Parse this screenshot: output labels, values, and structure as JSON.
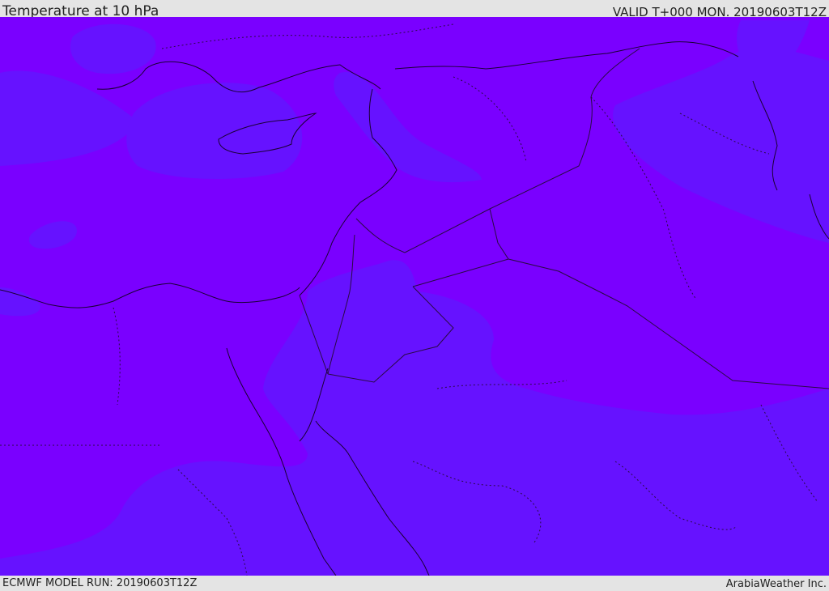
{
  "header": {
    "title": "Temperature at 10 hPa",
    "valid_time": "VALID T+000 MON. 20190603T12Z"
  },
  "footer": {
    "model_run": "ECMWF MODEL RUN: 20190603T12Z",
    "credit": "ArabiaWeather Inc."
  },
  "map": {
    "colors": {
      "warm_band": "#7a00ff",
      "cool_band": "#6612ff",
      "coast_line": "#1a0033",
      "border_line": "#2a0a44"
    }
  }
}
